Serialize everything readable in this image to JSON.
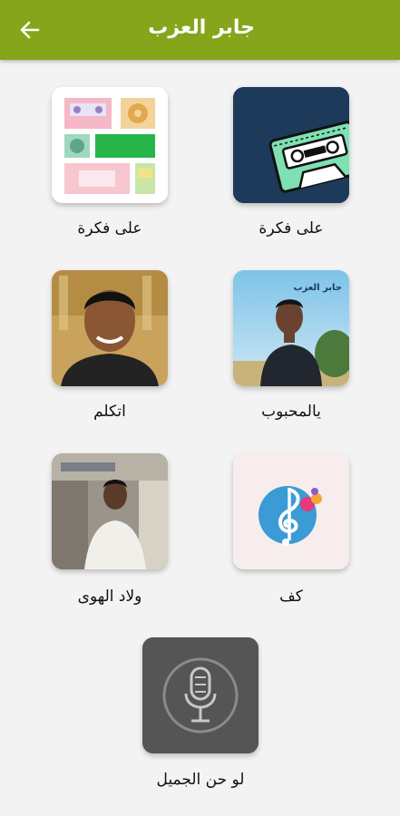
{
  "appbar": {
    "title": "جابر العزب",
    "back_icon": "arrow-left-icon"
  },
  "items": [
    {
      "label": "على فكرة",
      "art": "cassette-icon"
    },
    {
      "label": "على فكرة",
      "art": "retro-tapes-collage"
    },
    {
      "label": "يالمحبوب",
      "art": "singer-photo",
      "photo_caption": "جابر العزب"
    },
    {
      "label": "اتكلم",
      "art": "singer-portrait"
    },
    {
      "label": "كف",
      "art": "music-note-icon"
    },
    {
      "label": "ولاد الهوى",
      "art": "singer-photo-street"
    },
    {
      "label": "لو حن الجميل",
      "art": "microphone-icon"
    }
  ],
  "colors": {
    "appbar": "#86a51b",
    "background": "#f3f3f3",
    "cassette_tile": "#1e3a5a",
    "note_tile": "#f7eded",
    "mic_tile": "#555555"
  }
}
